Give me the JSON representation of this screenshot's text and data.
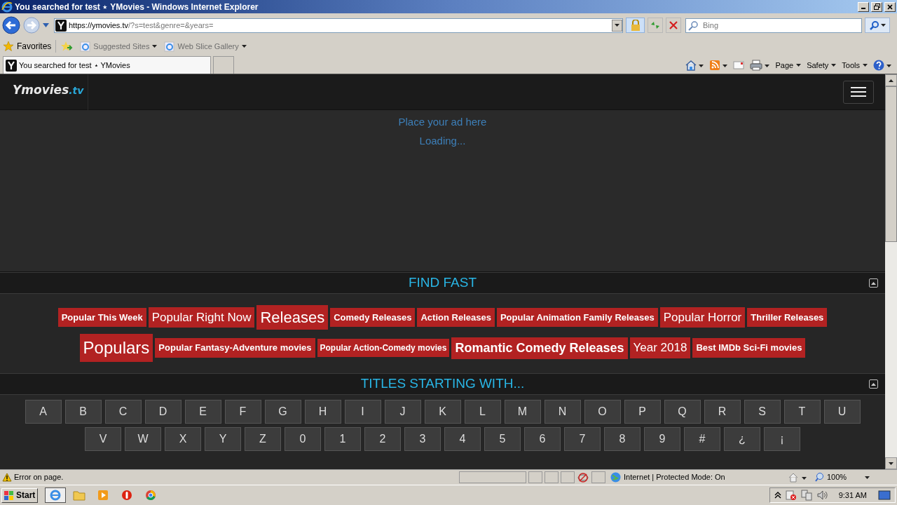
{
  "window": {
    "title": "You searched for test ⋆ YMovies - Windows Internet Explorer"
  },
  "address_bar": {
    "host": "https://ymovies.tv",
    "path": "/?s=test&genre=&years="
  },
  "search": {
    "placeholder": "Bing"
  },
  "favorites_bar": {
    "label": "Favorites",
    "items": [
      "Suggested Sites",
      "Web Slice Gallery"
    ]
  },
  "tabs": [
    {
      "label": "You searched for test ⋆ YMovies",
      "selected": true
    }
  ],
  "command_bar": [
    "Page",
    "Safety",
    "Tools"
  ],
  "site": {
    "logo": "Ymovies",
    "logo_suffix": ".tv",
    "ad": [
      "Place your ad here",
      "Loading..."
    ],
    "find_fast": {
      "title": "FIND FAST",
      "tags": [
        {
          "label": "Popular This Week",
          "kind": "small"
        },
        {
          "label": "Popular Right Now",
          "kind": "medium"
        },
        {
          "label": "Releases",
          "kind": "large"
        },
        {
          "label": "Comedy Releases",
          "kind": "small"
        },
        {
          "label": "Action Releases",
          "kind": "small"
        },
        {
          "label": "Popular Animation Family Releases",
          "kind": "small"
        },
        {
          "label": "Popular Horror",
          "kind": "medium"
        },
        {
          "label": "Thriller Releases",
          "kind": "small"
        },
        {
          "label": "Populars",
          "kind": "xlarge"
        },
        {
          "label": "Popular Fantasy-Adventure movies",
          "kind": "small"
        },
        {
          "label": "Popular Action-Comedy movies",
          "kind": "tiny"
        },
        {
          "label": "Romantic Comedy Releases",
          "kind": "bold"
        },
        {
          "label": "Year 2018",
          "kind": "medium"
        },
        {
          "label": "Best IMDb Sci-Fi movies",
          "kind": "small"
        }
      ]
    },
    "titles": {
      "title": "TITLES STARTING WITH...",
      "rows": [
        [
          "A",
          "B",
          "C",
          "D",
          "E",
          "F",
          "G",
          "H",
          "I",
          "J",
          "K",
          "L",
          "M",
          "N",
          "O",
          "P",
          "Q",
          "R",
          "S",
          "T",
          "U"
        ],
        [
          "V",
          "W",
          "X",
          "Y",
          "Z",
          "0",
          "1",
          "2",
          "3",
          "4",
          "5",
          "6",
          "7",
          "8",
          "9",
          "#",
          "¿",
          "¡"
        ]
      ]
    }
  },
  "status_bar": {
    "message": "Error on page.",
    "zone": "Internet | Protected Mode: On",
    "zoom": "100%"
  },
  "taskbar": {
    "start": "Start",
    "time": "9:31 AM"
  }
}
